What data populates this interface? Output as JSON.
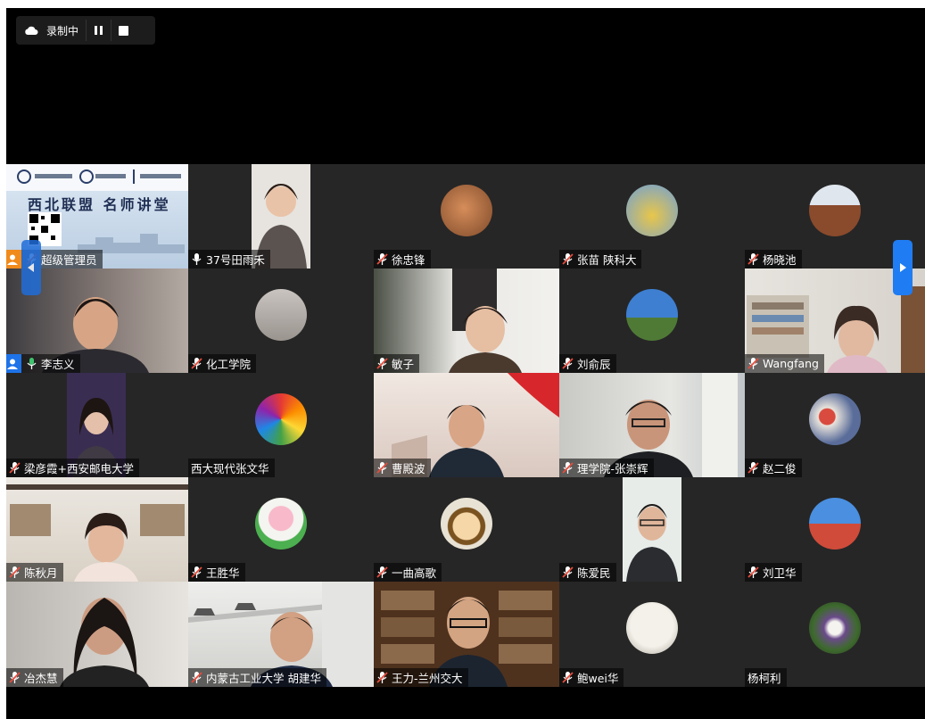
{
  "recording": {
    "label": "录制中",
    "pause_icon": "pause-icon",
    "stop_icon": "stop-icon",
    "cloud_icon": "cloud-icon"
  },
  "colors": {
    "host_badge": "#f08a1c",
    "cohost_badge": "#1e73e8",
    "nav_button": "#1f7cf2"
  },
  "banner": {
    "line1": "西北联盟 名师讲堂"
  },
  "participants": [
    {
      "name": "超级管理员",
      "mic": "muted",
      "role": "host"
    },
    {
      "name": "37号田雨禾",
      "mic": "on"
    },
    {
      "name": "徐忠锋",
      "mic": "muted"
    },
    {
      "name": "张苗 陕科大",
      "mic": "muted"
    },
    {
      "name": "杨晓池",
      "mic": "muted"
    },
    {
      "name": "李志义",
      "mic": "on",
      "role": "cohost"
    },
    {
      "name": "化工学院",
      "mic": "muted"
    },
    {
      "name": "敏子",
      "mic": "muted"
    },
    {
      "name": "刘俞辰",
      "mic": "muted"
    },
    {
      "name": "Wangfang",
      "mic": "muted"
    },
    {
      "name": "梁彦霞+西安邮电大学",
      "mic": "muted"
    },
    {
      "name": "西大现代张文华",
      "mic": "none"
    },
    {
      "name": "曹殿波",
      "mic": "muted"
    },
    {
      "name": "理学院-张崇辉",
      "mic": "muted"
    },
    {
      "name": "赵二俊",
      "mic": "muted"
    },
    {
      "name": "陈秋月",
      "mic": "muted"
    },
    {
      "name": "王胜华",
      "mic": "muted"
    },
    {
      "name": "一曲高歌",
      "mic": "muted"
    },
    {
      "name": "陈爱民",
      "mic": "muted"
    },
    {
      "name": "刘卫华",
      "mic": "muted"
    },
    {
      "name": "冶杰慧",
      "mic": "muted"
    },
    {
      "name": "内蒙古工业大学 胡建华",
      "mic": "muted"
    },
    {
      "name": "王力-兰州交大",
      "mic": "muted"
    },
    {
      "name": "鲍wei华",
      "mic": "muted"
    },
    {
      "name": "杨柯利",
      "mic": "none"
    }
  ]
}
